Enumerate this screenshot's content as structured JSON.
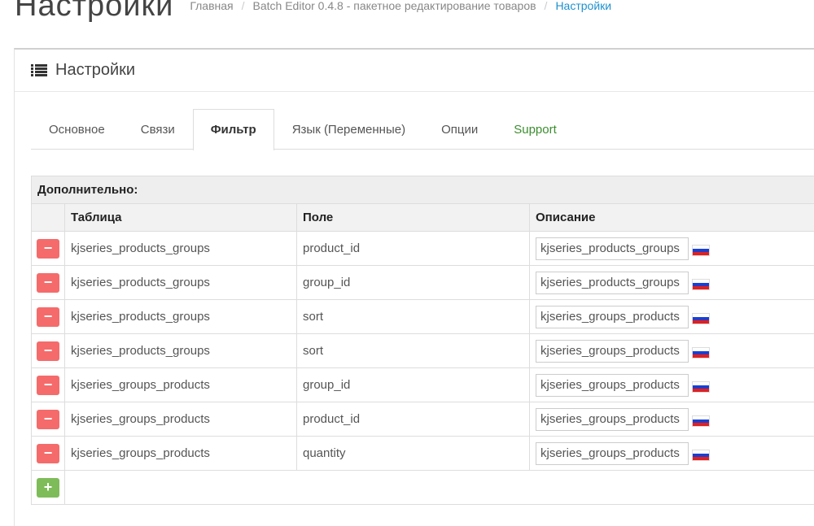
{
  "header": {
    "title": "Настройки",
    "breadcrumb": [
      "Главная",
      "Batch Editor 0.4.8 - пакетное редактирование товаров",
      "Настройки"
    ],
    "separator": "/"
  },
  "panel": {
    "title": "Настройки",
    "icon": "list-icon"
  },
  "tabs": [
    {
      "label": "Основное"
    },
    {
      "label": "Связи"
    },
    {
      "label": "Фильтр",
      "active": true
    },
    {
      "label": "Язык (Переменные)"
    },
    {
      "label": "Опции"
    },
    {
      "label": "Support"
    }
  ],
  "table": {
    "caption": "Дополнительно:",
    "columns": [
      "Таблица",
      "Поле",
      "Описание"
    ],
    "rows": [
      {
        "table": "kjseries_products_groups",
        "field": "product_id",
        "description": "kjseries_products_groups"
      },
      {
        "table": "kjseries_products_groups",
        "field": "group_id",
        "description": "kjseries_products_groups"
      },
      {
        "table": "kjseries_products_groups",
        "field": "sort",
        "description": "kjseries_groups_products"
      },
      {
        "table": "kjseries_products_groups",
        "field": "sort",
        "description": "kjseries_groups_products"
      },
      {
        "table": "kjseries_groups_products",
        "field": "group_id",
        "description": "kjseries_groups_products"
      },
      {
        "table": "kjseries_groups_products",
        "field": "product_id",
        "description": "kjseries_groups_products"
      },
      {
        "table": "kjseries_groups_products",
        "field": "quantity",
        "description": "kjseries_groups_products"
      }
    ],
    "remove_symbol": "−",
    "add_symbol": "+"
  },
  "colors": {
    "remove_button": "#f56b6b",
    "add_button": "#7ebc59",
    "breadcrumb_active": "#1e91cf",
    "support_tab": "#3c8d2f"
  }
}
